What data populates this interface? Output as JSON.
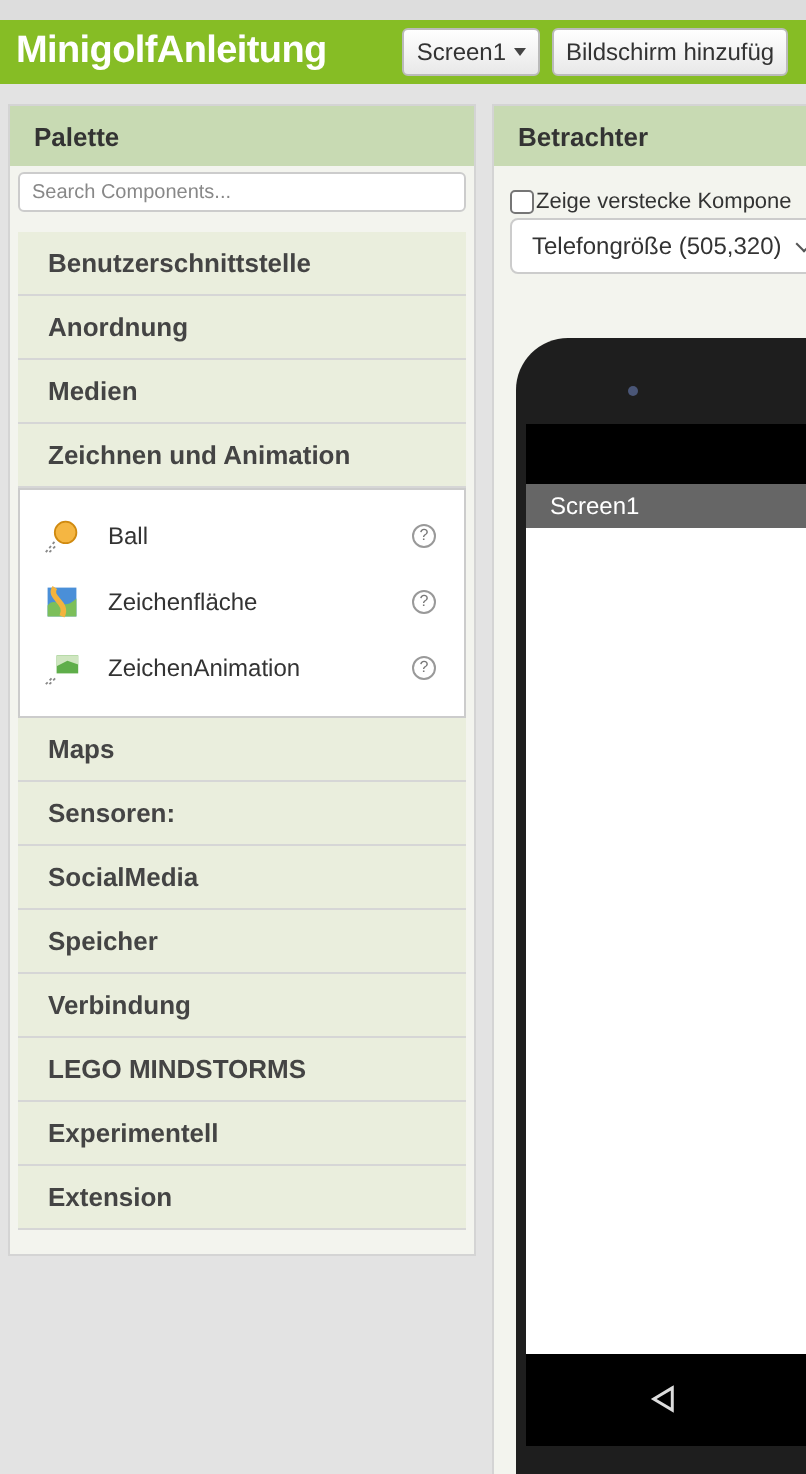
{
  "app_bar": {
    "title": "MinigolfAnleitung",
    "screen_button": "Screen1",
    "add_screen_button": "Bildschirm hinzufüg"
  },
  "palette": {
    "title": "Palette",
    "search": {
      "placeholder": "Search Components..."
    },
    "categories": [
      {
        "label": "Benutzerschnittstelle"
      },
      {
        "label": "Anordnung"
      },
      {
        "label": "Medien"
      },
      {
        "label": "Zeichnen und Animation",
        "items": [
          {
            "label": "Ball",
            "help": "?",
            "kind": "ball"
          },
          {
            "label": "Zeichenfläche",
            "help": "?",
            "kind": "canvas"
          },
          {
            "label": "ZeichenAnimation",
            "help": "?",
            "kind": "sprite"
          }
        ]
      },
      {
        "label": "Maps"
      },
      {
        "label": "Sensoren:"
      },
      {
        "label": "SocialMedia"
      },
      {
        "label": "Speicher"
      },
      {
        "label": "Verbindung"
      },
      {
        "label": "LEGO MINDSTORMS"
      },
      {
        "label": "Experimentell"
      },
      {
        "label": "Extension"
      }
    ]
  },
  "viewer": {
    "title": "Betrachter",
    "show_hidden": {
      "label": "Zeige verstecke Kompone",
      "checked": false
    },
    "size_select": "Telefongröße (505,320)",
    "phone": {
      "screen_title": "Screen1"
    }
  }
}
